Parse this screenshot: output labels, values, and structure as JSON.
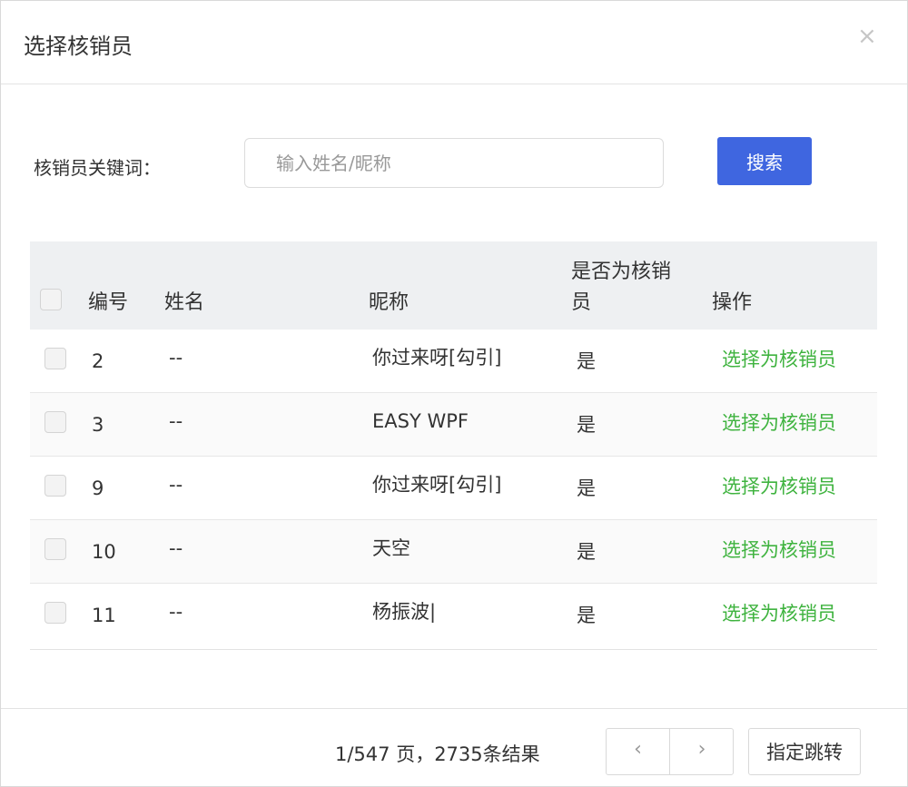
{
  "dialog": {
    "title": "选择核销员",
    "close_icon": "×"
  },
  "search": {
    "label": "核销员关键词：",
    "placeholder": "输入姓名/昵称",
    "value": "",
    "button_label": "搜索"
  },
  "table": {
    "headers": {
      "id": "编号",
      "name": "姓名",
      "nickname": "昵称",
      "is_verifier_line1": "是否为核",
      "is_verifier_line1b": "销",
      "is_verifier_line2": "员",
      "action": "操作"
    },
    "rows": [
      {
        "id": "2",
        "name": "--",
        "nickname": "你过来呀[勾引]",
        "is_verifier": "是",
        "action": "选择为核销员"
      },
      {
        "id": "3",
        "name": "--",
        "nickname": "EASY WPF",
        "is_verifier": "是",
        "action": "选择为核销员"
      },
      {
        "id": "9",
        "name": "--",
        "nickname": "你过来呀[勾引]",
        "is_verifier": "是",
        "action": "选择为核销员"
      },
      {
        "id": "10",
        "name": "--",
        "nickname": "天空",
        "is_verifier": "是",
        "action": "选择为核销员"
      },
      {
        "id": "11",
        "name": "--",
        "nickname": "杨振波|",
        "is_verifier": "是",
        "action": "选择为核销员"
      }
    ]
  },
  "pagination": {
    "info": "1/547 页，2735条结果",
    "prev_icon": "‹",
    "next_icon": "›",
    "jump_label": "指定跳转"
  },
  "colors": {
    "primary": "#3f66e0",
    "action_green": "#3fb33f"
  }
}
